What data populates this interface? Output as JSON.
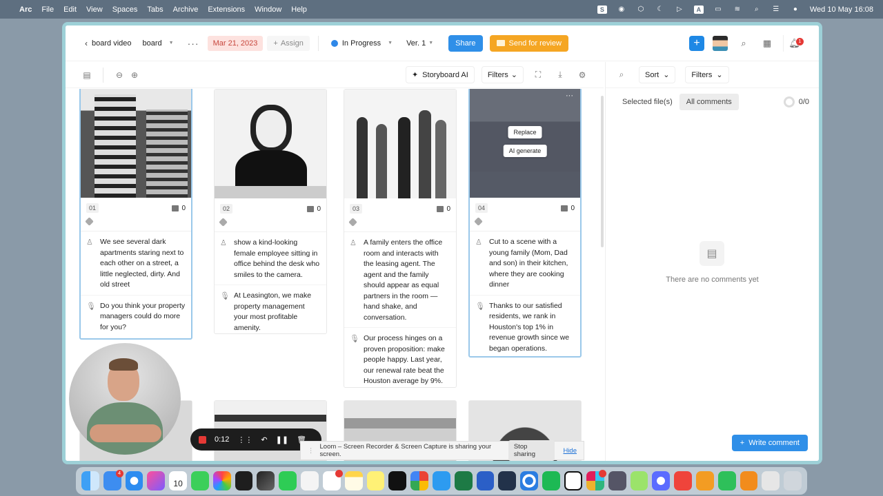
{
  "menubar": {
    "app": "Arc",
    "menus": [
      "File",
      "Edit",
      "View",
      "Spaces",
      "Tabs",
      "Archive",
      "Extensions",
      "Window",
      "Help"
    ],
    "clock": "Wed 10 May  16:08"
  },
  "header": {
    "back_label": "board video",
    "board_label": "board",
    "date": "Mar 21, 2023",
    "assign_label": "Assign",
    "status_label": "In Progress",
    "version_label": "Ver. 1",
    "share_label": "Share",
    "review_label": "Send for review",
    "notifications": "1"
  },
  "toolbar": {
    "storyboard_ai": "Storyboard AI",
    "filters": "Filters"
  },
  "right_panel": {
    "sort": "Sort",
    "filters": "Filters",
    "tab_selected": "Selected file(s)",
    "tab_all": "All comments",
    "count": "0/0",
    "empty": "There are no comments yet",
    "write": "Write comment"
  },
  "frames": [
    {
      "num": "01",
      "comments": "0",
      "action": "We see several dark apartments staring next to each other on a street, a little neglected, dirty. And old street",
      "voice": "Do you think your property managers could do more for you?"
    },
    {
      "num": "02",
      "comments": "0",
      "action": "show a kind-looking female employee sitting in office behind the desk who smiles to the camera.",
      "voice": "At Leasington, we make property management your most profitable amenity."
    },
    {
      "num": "03",
      "comments": "0",
      "action": "A family enters the office room and interacts with the leasing agent. The agent and the family should appear as equal partners in the room — hand shake, and conversation.",
      "voice": "Our process hinges on a proven proposition: make people happy. Last year, our renewal rate beat the Houston average by 9%."
    },
    {
      "num": "04",
      "comments": "0",
      "action": "Cut to a scene with a young family (Mom, Dad and son) in their kitchen, where they are cooking dinner",
      "voice": "Thanks to our satisfied residents, we rank in Houston's top 1% in revenue growth since we began operations."
    }
  ],
  "hover_actions": {
    "replace": "Replace",
    "ai_generate": "AI generate"
  },
  "loom": {
    "timer": "0:12",
    "sharing_msg": "Loom – Screen Recorder & Screen Capture is sharing your screen.",
    "stop": "Stop sharing",
    "hide": "Hide"
  },
  "dock": {
    "calendar_day": "10",
    "mail_badge": "4"
  }
}
